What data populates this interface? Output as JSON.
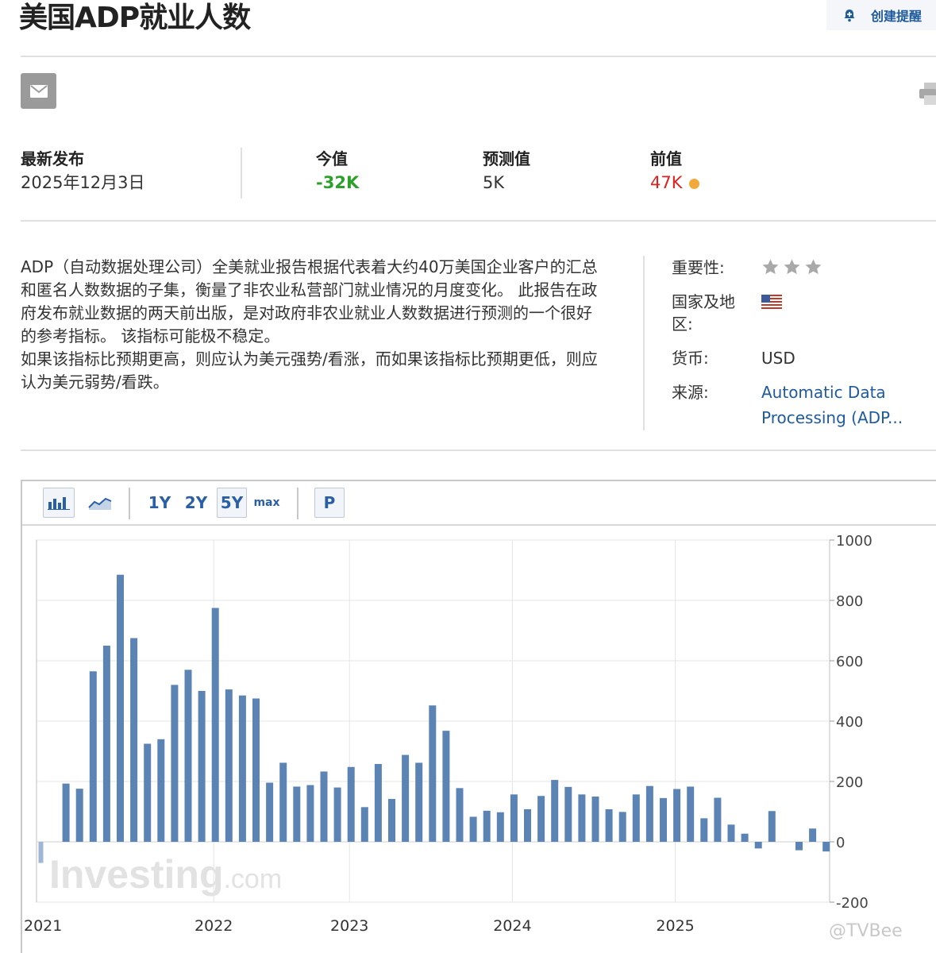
{
  "header": {
    "title": "美国ADP就业人数",
    "alert_label": "创建提醒"
  },
  "stats": {
    "latest_label": "最新发布",
    "latest_value": "2025年12月3日",
    "actual_label": "今值",
    "actual_value": "-32K",
    "forecast_label": "预测值",
    "forecast_value": "5K",
    "previous_label": "前值",
    "previous_value": "47K",
    "colors": {
      "actual": "#2ba12b",
      "previous": "#e02020",
      "dot": "#f2a93b"
    }
  },
  "description": {
    "p1": "ADP（自动数据处理公司）全美就业报告根据代表着大约40万美国企业客户的汇总和匿名人数数据的子集，衡量了非农业私营部门就业情况的月度变化。 此报告在政府发布就业数据的两天前出版，是对政府非农业就业人数数据进行预测的一个很好的参考指标。 该指标可能极不稳定。",
    "p2": "如果该指标比预期更高，则应认为美元强势/看涨，而如果该指标比预期更低，则应认为美元弱势/看跌。"
  },
  "meta": {
    "importance_label": "重要性:",
    "importance_stars": 3,
    "country_label": "国家及地区:",
    "country_flag": "us-flag-icon",
    "currency_label": "货币:",
    "currency_value": "USD",
    "source_label": "来源:",
    "source_line1": "Automatic Data",
    "source_line2": "Processing (ADP..."
  },
  "toolbar": {
    "chart_icons": [
      "bar-chart-icon",
      "line-chart-icon"
    ],
    "ranges": [
      "1Y",
      "2Y",
      "5Y",
      "max"
    ],
    "active_range": "5Y",
    "p_label": "P"
  },
  "watermark": "@TVBee",
  "chart_data": {
    "type": "bar",
    "title": "",
    "xlabel": "",
    "ylabel": "",
    "ylim": [
      -200,
      1000
    ],
    "yticks": [
      1000,
      800,
      600,
      400,
      200,
      0,
      -200
    ],
    "x_labels": [
      {
        "label": "2021",
        "index": 0
      },
      {
        "label": "2022",
        "index": 12
      },
      {
        "label": "2023",
        "index": 22
      },
      {
        "label": "2024",
        "index": 34
      },
      {
        "label": "2025",
        "index": 46
      }
    ],
    "grid": true,
    "axis_position": "right",
    "bar_color": "#5b84b5",
    "logo": "Investing.com",
    "series": [
      {
        "values": [
          -70,
          193,
          176,
          565,
          650,
          885,
          675,
          325,
          340,
          520,
          570,
          500,
          775,
          505,
          485,
          475,
          196,
          262,
          183,
          188,
          233,
          180,
          248,
          115,
          258,
          142,
          288,
          262,
          452,
          368,
          178,
          83,
          103,
          98,
          157,
          108,
          152,
          205,
          182,
          157,
          150,
          108,
          99,
          157,
          185,
          145,
          175,
          183,
          78,
          146,
          57,
          27,
          -22,
          102,
          0,
          -28,
          44,
          -32
        ]
      }
    ]
  }
}
